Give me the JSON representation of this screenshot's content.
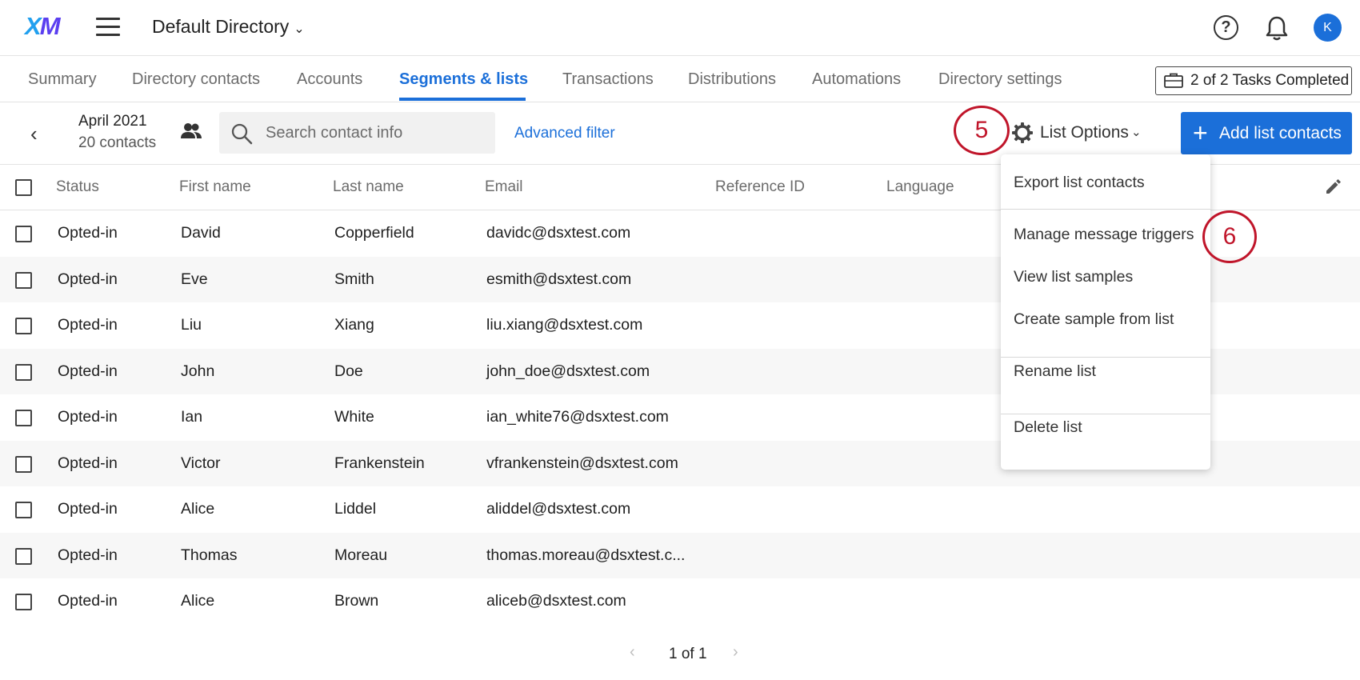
{
  "header": {
    "logo_x": "X",
    "logo_m": "M",
    "directory_label": "Default Directory",
    "help_glyph": "?",
    "avatar_initial": "K"
  },
  "tabs": [
    {
      "label": "Summary"
    },
    {
      "label": "Directory contacts"
    },
    {
      "label": "Accounts"
    },
    {
      "label": "Segments & lists",
      "active": true
    },
    {
      "label": "Transactions"
    },
    {
      "label": "Distributions"
    },
    {
      "label": "Automations"
    },
    {
      "label": "Directory settings"
    }
  ],
  "tasks": {
    "label": "2 of 2 Tasks Completed"
  },
  "toolbar": {
    "list_name": "April 2021",
    "list_count": "20 contacts",
    "search_placeholder": "Search contact info",
    "advanced_filter": "Advanced filter",
    "step5": "5",
    "list_options": "List Options",
    "add_contacts": "Add list contacts"
  },
  "table": {
    "columns": [
      "Status",
      "First name",
      "Last name",
      "Email",
      "Reference ID",
      "Language"
    ],
    "rows": [
      {
        "status": "Opted-in",
        "first": "David",
        "last": "Copperfield",
        "email": "davidc@dsxtest.com"
      },
      {
        "status": "Opted-in",
        "first": "Eve",
        "last": "Smith",
        "email": "esmith@dsxtest.com"
      },
      {
        "status": "Opted-in",
        "first": "Liu",
        "last": "Xiang",
        "email": "liu.xiang@dsxtest.com"
      },
      {
        "status": "Opted-in",
        "first": "John",
        "last": "Doe",
        "email": "john_doe@dsxtest.com"
      },
      {
        "status": "Opted-in",
        "first": "Ian",
        "last": "White",
        "email": "ian_white76@dsxtest.com"
      },
      {
        "status": "Opted-in",
        "first": "Victor",
        "last": "Frankenstein",
        "email": "vfrankenstein@dsxtest.com"
      },
      {
        "status": "Opted-in",
        "first": "Alice",
        "last": "Liddel",
        "email": "aliddel@dsxtest.com"
      },
      {
        "status": "Opted-in",
        "first": "Thomas",
        "last": "Moreau",
        "email": "thomas.moreau@dsxtest.c..."
      },
      {
        "status": "Opted-in",
        "first": "Alice",
        "last": "Brown",
        "email": "aliceb@dsxtest.com"
      }
    ]
  },
  "menu": {
    "items": [
      "Export list contacts",
      "Manage message triggers",
      "View list samples",
      "Create sample from list",
      "Rename list",
      "Delete list"
    ],
    "step6": "6"
  },
  "pagination": {
    "label": "1 of 1"
  },
  "colors": {
    "accent": "#1b6fd9",
    "annotation": "#c0152a"
  }
}
